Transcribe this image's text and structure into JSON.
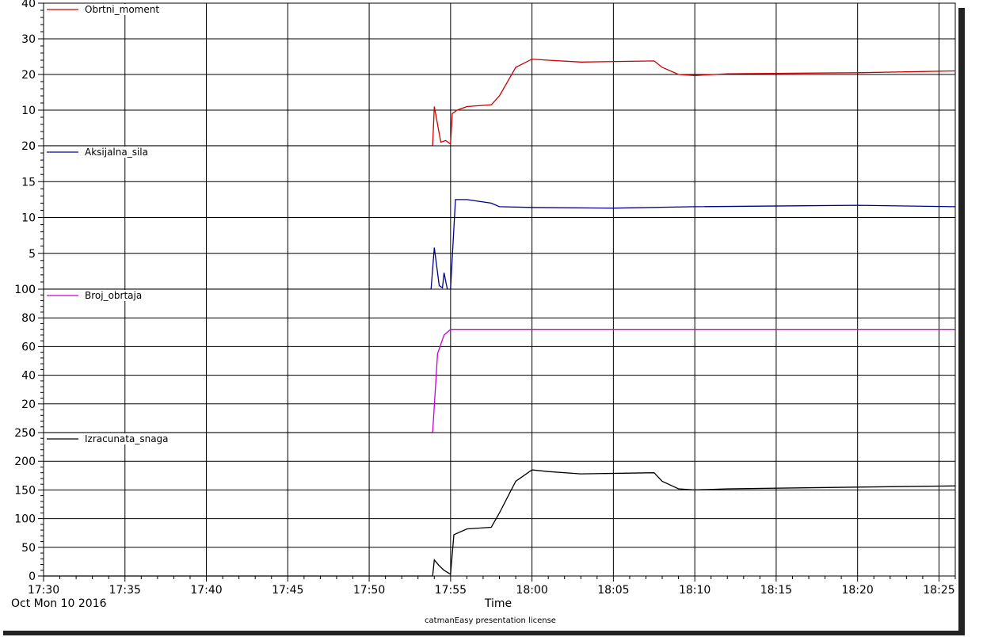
{
  "x_axis": {
    "label": "Time",
    "date_label": "Oct Mon 10 2016",
    "ticks": [
      "17:30",
      "17:35",
      "17:40",
      "17:45",
      "17:50",
      "17:55",
      "18:00",
      "18:05",
      "18:10",
      "18:15",
      "18:20",
      "18:25"
    ],
    "range": [
      "17:30",
      "18:26"
    ]
  },
  "footer": {
    "license": "catmanEasy presentation license"
  },
  "chart_data": [
    {
      "type": "line",
      "series": [
        {
          "name": "Obrtni_moment",
          "color": "#cc0000",
          "points": [
            [
              "17:30",
              0
            ],
            [
              "17:50",
              0
            ],
            [
              "17:53.9",
              0
            ],
            [
              "17:54.0",
              11
            ],
            [
              "17:54.2",
              6
            ],
            [
              "17:54.4",
              1
            ],
            [
              "17:54.7",
              1.5
            ],
            [
              "17:55.0",
              0.5
            ],
            [
              "17:55.1",
              9
            ],
            [
              "17:55.4",
              10
            ],
            [
              "17:56",
              11
            ],
            [
              "17:57.5",
              11.5
            ],
            [
              "17:58",
              14
            ],
            [
              "17:59",
              22
            ],
            [
              "18:00",
              24.3
            ],
            [
              "18:01",
              24
            ],
            [
              "18:03",
              23.5
            ],
            [
              "18:07.5",
              23.8
            ],
            [
              "18:08",
              22
            ],
            [
              "18:09",
              20
            ],
            [
              "18:10",
              19.7
            ],
            [
              "18:12",
              20.2
            ],
            [
              "18:20",
              20.5
            ],
            [
              "18:26",
              21
            ]
          ]
        }
      ],
      "ylim": [
        0,
        40
      ],
      "yticks": [
        0,
        10,
        20,
        30,
        40
      ],
      "grid": true,
      "legend": "top-left"
    },
    {
      "type": "line",
      "series": [
        {
          "name": "Aksijalna_sila",
          "color": "#00008b",
          "points": [
            [
              "17:30",
              0
            ],
            [
              "17:53.8",
              0
            ],
            [
              "17:54.0",
              5.8
            ],
            [
              "17:54.3",
              0.5
            ],
            [
              "17:54.5",
              0.2
            ],
            [
              "17:54.6",
              2.3
            ],
            [
              "17:54.8",
              0
            ],
            [
              "17:55.0",
              0
            ],
            [
              "17:55.3",
              12.5
            ],
            [
              "17:56",
              12.5
            ],
            [
              "17:57.5",
              12
            ],
            [
              "17:58",
              11.5
            ],
            [
              "18:00",
              11.4
            ],
            [
              "18:05",
              11.3
            ],
            [
              "18:10",
              11.5
            ],
            [
              "18:20",
              11.7
            ],
            [
              "18:26",
              11.5
            ]
          ]
        }
      ],
      "ylim": [
        0,
        20
      ],
      "yticks": [
        0,
        5,
        10,
        15,
        20
      ],
      "grid": true,
      "legend": "top-left"
    },
    {
      "type": "line",
      "series": [
        {
          "name": "Broj_obrtaja",
          "color": "#cc00cc",
          "points": [
            [
              "17:30",
              0
            ],
            [
              "17:53.9",
              0
            ],
            [
              "17:54.2",
              55
            ],
            [
              "17:54.6",
              68
            ],
            [
              "17:55",
              72
            ],
            [
              "18:26",
              72
            ]
          ]
        }
      ],
      "ylim": [
        0,
        100
      ],
      "yticks": [
        0,
        20,
        40,
        60,
        80,
        100
      ],
      "grid": true,
      "legend": "top-left"
    },
    {
      "type": "line",
      "series": [
        {
          "name": "Izracunata_snaga",
          "color": "#000000",
          "points": [
            [
              "17:30",
              0
            ],
            [
              "17:50",
              0
            ],
            [
              "17:53.9",
              0
            ],
            [
              "17:54.0",
              28
            ],
            [
              "17:54.3",
              18
            ],
            [
              "17:54.6",
              10
            ],
            [
              "17:55",
              3
            ],
            [
              "17:55.2",
              72
            ],
            [
              "17:56",
              82
            ],
            [
              "17:57.5",
              85
            ],
            [
              "17:58",
              110
            ],
            [
              "17:59",
              165
            ],
            [
              "18:00",
              185
            ],
            [
              "18:01",
              182
            ],
            [
              "18:03",
              178
            ],
            [
              "18:07.5",
              180
            ],
            [
              "18:08",
              165
            ],
            [
              "18:09",
              152
            ],
            [
              "18:10",
              150
            ],
            [
              "18:12",
              152
            ],
            [
              "18:20",
              155
            ],
            [
              "18:26",
              157
            ]
          ]
        }
      ],
      "ylim": [
        0,
        250
      ],
      "yticks": [
        0,
        50,
        100,
        150,
        200,
        250
      ],
      "grid": true,
      "legend": "top-left"
    }
  ]
}
